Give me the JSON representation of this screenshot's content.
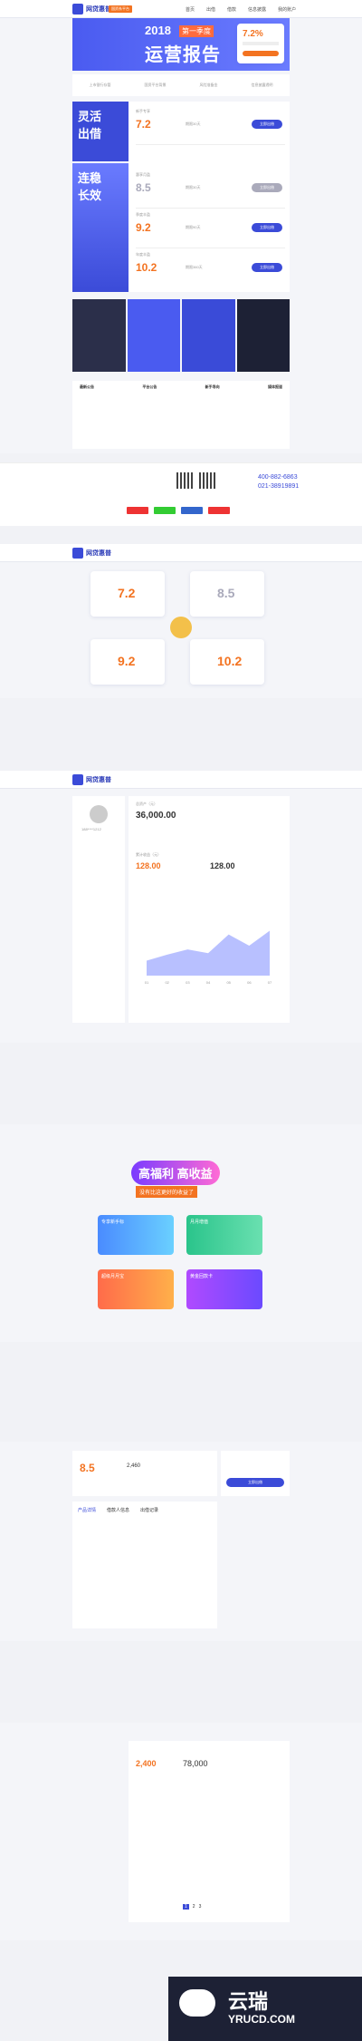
{
  "header": {
    "brand": "网贷惠普",
    "tag": "国资系平台"
  },
  "nav": [
    "首页",
    "出借",
    "借款",
    "信息披露",
    "我的账户"
  ],
  "banner": {
    "year": "2018",
    "subtitle": "第一季度",
    "title": "运营报告"
  },
  "features": [
    "上市银行存管",
    "国资平台背景",
    "风险准备金",
    "信息披露透明"
  ],
  "products": {
    "side1": "灵活\n出借",
    "side2": "连稳\n长效",
    "rows": [
      {
        "name": "新手专享",
        "rate": "7.2",
        "unit": "%",
        "term": "期限30天",
        "btn": "立即出借"
      },
      {
        "name": "惠享月盈",
        "rate": "8.5",
        "unit": "%",
        "term": "期限30天",
        "btn": "立即出借"
      },
      {
        "name": "季度丰盈",
        "rate": "9.2",
        "unit": "%",
        "term": "期限90天",
        "btn": "立即出借"
      },
      {
        "name": "年度丰盈",
        "rate": "10.2",
        "unit": "%",
        "term": "期限360天",
        "btn": "立即出借"
      }
    ]
  },
  "news": {
    "cols": [
      "最新公告",
      "平台公告",
      "新手导向",
      "媒体报道"
    ]
  },
  "contact": {
    "tel1": "400-882-6863",
    "tel2": "021-38919891"
  },
  "account": {
    "balance_label": "总资产（元）",
    "balance": "36,000.00",
    "income_label": "累计收益（元）",
    "income": "128.00",
    "yesterday": "128.00",
    "user": "188****1212"
  },
  "chart_data": {
    "type": "area",
    "categories": [
      "01",
      "02",
      "03",
      "04",
      "05",
      "06",
      "07"
    ],
    "values": [
      20,
      28,
      35,
      30,
      55,
      40,
      60
    ],
    "ylim": [
      0,
      80
    ]
  },
  "promo": {
    "title": "高福利 高收益",
    "sub": "没有比这更好的收益了",
    "cards": [
      "专享新手标",
      "月月增值",
      "超级月月宝",
      "黄金回款卡"
    ]
  },
  "detail": {
    "rate": "8.5",
    "amount": "2,460",
    "income": "2,400",
    "total": "78,000",
    "btn": "立即出借",
    "tabs": [
      "产品详情",
      "借款人信息",
      "出借记录"
    ]
  },
  "pager": [
    "1",
    "2",
    "3"
  ],
  "watermark": {
    "cn": "云瑞",
    "en": "YRUCD.COM"
  }
}
